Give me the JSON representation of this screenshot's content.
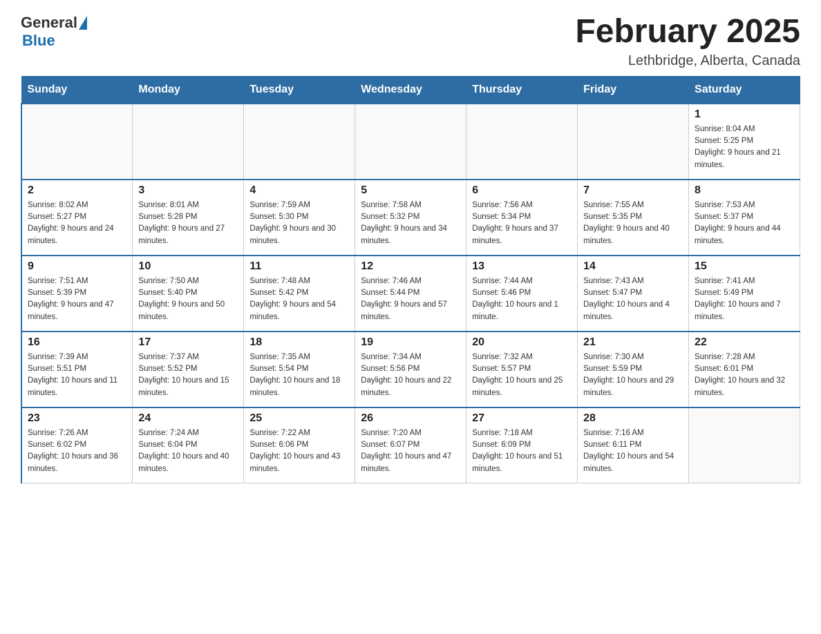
{
  "header": {
    "logo_general": "General",
    "logo_blue": "Blue",
    "month_title": "February 2025",
    "location": "Lethbridge, Alberta, Canada"
  },
  "weekdays": [
    "Sunday",
    "Monday",
    "Tuesday",
    "Wednesday",
    "Thursday",
    "Friday",
    "Saturday"
  ],
  "weeks": [
    [
      {
        "day": "",
        "info": ""
      },
      {
        "day": "",
        "info": ""
      },
      {
        "day": "",
        "info": ""
      },
      {
        "day": "",
        "info": ""
      },
      {
        "day": "",
        "info": ""
      },
      {
        "day": "",
        "info": ""
      },
      {
        "day": "1",
        "info": "Sunrise: 8:04 AM\nSunset: 5:25 PM\nDaylight: 9 hours and 21 minutes."
      }
    ],
    [
      {
        "day": "2",
        "info": "Sunrise: 8:02 AM\nSunset: 5:27 PM\nDaylight: 9 hours and 24 minutes."
      },
      {
        "day": "3",
        "info": "Sunrise: 8:01 AM\nSunset: 5:28 PM\nDaylight: 9 hours and 27 minutes."
      },
      {
        "day": "4",
        "info": "Sunrise: 7:59 AM\nSunset: 5:30 PM\nDaylight: 9 hours and 30 minutes."
      },
      {
        "day": "5",
        "info": "Sunrise: 7:58 AM\nSunset: 5:32 PM\nDaylight: 9 hours and 34 minutes."
      },
      {
        "day": "6",
        "info": "Sunrise: 7:56 AM\nSunset: 5:34 PM\nDaylight: 9 hours and 37 minutes."
      },
      {
        "day": "7",
        "info": "Sunrise: 7:55 AM\nSunset: 5:35 PM\nDaylight: 9 hours and 40 minutes."
      },
      {
        "day": "8",
        "info": "Sunrise: 7:53 AM\nSunset: 5:37 PM\nDaylight: 9 hours and 44 minutes."
      }
    ],
    [
      {
        "day": "9",
        "info": "Sunrise: 7:51 AM\nSunset: 5:39 PM\nDaylight: 9 hours and 47 minutes."
      },
      {
        "day": "10",
        "info": "Sunrise: 7:50 AM\nSunset: 5:40 PM\nDaylight: 9 hours and 50 minutes."
      },
      {
        "day": "11",
        "info": "Sunrise: 7:48 AM\nSunset: 5:42 PM\nDaylight: 9 hours and 54 minutes."
      },
      {
        "day": "12",
        "info": "Sunrise: 7:46 AM\nSunset: 5:44 PM\nDaylight: 9 hours and 57 minutes."
      },
      {
        "day": "13",
        "info": "Sunrise: 7:44 AM\nSunset: 5:46 PM\nDaylight: 10 hours and 1 minute."
      },
      {
        "day": "14",
        "info": "Sunrise: 7:43 AM\nSunset: 5:47 PM\nDaylight: 10 hours and 4 minutes."
      },
      {
        "day": "15",
        "info": "Sunrise: 7:41 AM\nSunset: 5:49 PM\nDaylight: 10 hours and 7 minutes."
      }
    ],
    [
      {
        "day": "16",
        "info": "Sunrise: 7:39 AM\nSunset: 5:51 PM\nDaylight: 10 hours and 11 minutes."
      },
      {
        "day": "17",
        "info": "Sunrise: 7:37 AM\nSunset: 5:52 PM\nDaylight: 10 hours and 15 minutes."
      },
      {
        "day": "18",
        "info": "Sunrise: 7:35 AM\nSunset: 5:54 PM\nDaylight: 10 hours and 18 minutes."
      },
      {
        "day": "19",
        "info": "Sunrise: 7:34 AM\nSunset: 5:56 PM\nDaylight: 10 hours and 22 minutes."
      },
      {
        "day": "20",
        "info": "Sunrise: 7:32 AM\nSunset: 5:57 PM\nDaylight: 10 hours and 25 minutes."
      },
      {
        "day": "21",
        "info": "Sunrise: 7:30 AM\nSunset: 5:59 PM\nDaylight: 10 hours and 29 minutes."
      },
      {
        "day": "22",
        "info": "Sunrise: 7:28 AM\nSunset: 6:01 PM\nDaylight: 10 hours and 32 minutes."
      }
    ],
    [
      {
        "day": "23",
        "info": "Sunrise: 7:26 AM\nSunset: 6:02 PM\nDaylight: 10 hours and 36 minutes."
      },
      {
        "day": "24",
        "info": "Sunrise: 7:24 AM\nSunset: 6:04 PM\nDaylight: 10 hours and 40 minutes."
      },
      {
        "day": "25",
        "info": "Sunrise: 7:22 AM\nSunset: 6:06 PM\nDaylight: 10 hours and 43 minutes."
      },
      {
        "day": "26",
        "info": "Sunrise: 7:20 AM\nSunset: 6:07 PM\nDaylight: 10 hours and 47 minutes."
      },
      {
        "day": "27",
        "info": "Sunrise: 7:18 AM\nSunset: 6:09 PM\nDaylight: 10 hours and 51 minutes."
      },
      {
        "day": "28",
        "info": "Sunrise: 7:16 AM\nSunset: 6:11 PM\nDaylight: 10 hours and 54 minutes."
      },
      {
        "day": "",
        "info": ""
      }
    ]
  ]
}
